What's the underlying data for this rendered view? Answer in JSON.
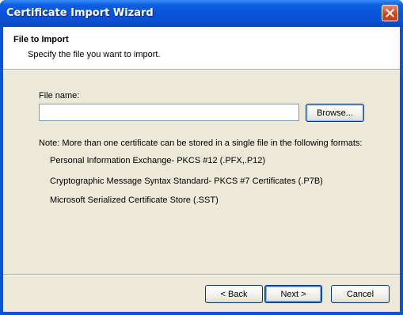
{
  "window": {
    "title": "Certificate Import Wizard"
  },
  "header": {
    "title": "File to Import",
    "subtitle": "Specify the file you want to import."
  },
  "form": {
    "file_label": "File name:",
    "file_value": "",
    "browse_label": "Browse..."
  },
  "note": {
    "text": "Note:  More than one certificate can be stored in a single file in the following formats:",
    "formats": [
      "Personal Information Exchange- PKCS #12 (.PFX,.P12)",
      "Cryptographic Message Syntax Standard- PKCS #7 Certificates (.P7B)",
      "Microsoft Serialized Certificate Store (.SST)"
    ]
  },
  "buttons": {
    "back": "< Back",
    "next": "Next >",
    "cancel": "Cancel"
  },
  "colors": {
    "titlebar": "#0752d8",
    "client": "#ece9d8",
    "close": "#d5451f"
  }
}
